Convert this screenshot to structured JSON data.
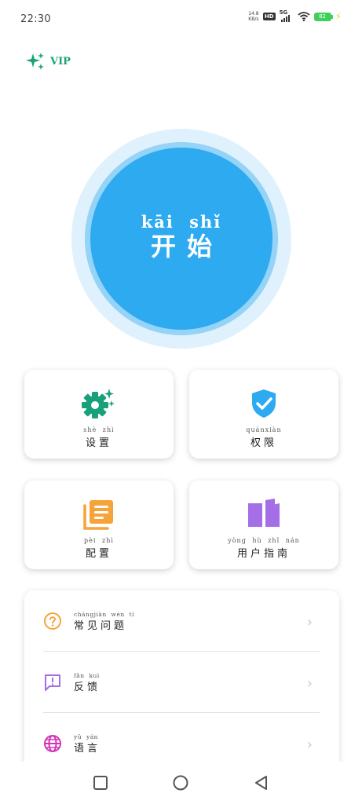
{
  "status_bar": {
    "time": "22:30",
    "net_speed_value": "14.8",
    "net_speed_unit": "KB/s",
    "hd": "HD",
    "signal": "5G",
    "battery": "82"
  },
  "vip": {
    "label": "VIP",
    "color": "#1aa37a"
  },
  "start_button": {
    "pinyin": "kāi shǐ",
    "hanzi": "开始",
    "color": "#2eaaf0"
  },
  "cards": [
    {
      "pinyin": "shè zhì",
      "hanzi": "设置",
      "icon": "gear-sparkle-icon",
      "color": "#18a07a"
    },
    {
      "pinyin": "quánxiàn",
      "hanzi": "权限",
      "icon": "shield-check-icon",
      "color": "#2eaaf0"
    },
    {
      "pinyin": "pèi zhì",
      "hanzi": "配置",
      "icon": "document-stack-icon",
      "color": "#f6a43a"
    },
    {
      "pinyin": "yòng hù zhǐ nán",
      "hanzi": "用户指南",
      "icon": "open-book-icon",
      "color": "#a46ee6"
    }
  ],
  "list": [
    {
      "pinyin": "chángjiàn wèn tí",
      "hanzi": "常见问题",
      "icon": "question-circle-icon",
      "color": "#f6a43a",
      "arrow": "›"
    },
    {
      "pinyin": "fǎn kuì",
      "hanzi": "反馈",
      "icon": "feedback-message-icon",
      "color": "#a46ee6",
      "arrow": "›"
    },
    {
      "pinyin": "yǔ yán",
      "hanzi": "语言",
      "icon": "globe-icon",
      "color": "#d235b8",
      "arrow": "›"
    }
  ],
  "nav": [
    "recents-button",
    "home-button",
    "back-button"
  ]
}
